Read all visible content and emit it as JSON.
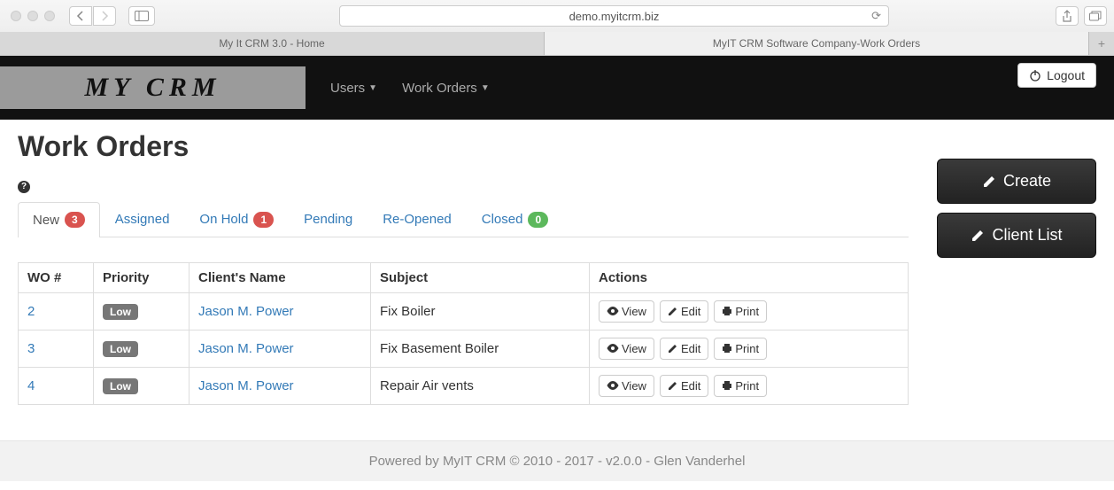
{
  "browser": {
    "url": "demo.myitcrm.biz",
    "tabs": [
      {
        "title": "My It CRM 3.0 - Home",
        "active": false
      },
      {
        "title": "MyIT CRM Software Company-Work Orders",
        "active": true
      }
    ]
  },
  "navbar": {
    "brand": "MY CRM",
    "menu": {
      "users": "Users",
      "work_orders": "Work Orders"
    },
    "logout": "Logout"
  },
  "page": {
    "title": "Work Orders"
  },
  "tabs": [
    {
      "label": "New",
      "badge": "3",
      "badge_color": "red",
      "active": true
    },
    {
      "label": "Assigned",
      "badge": null,
      "active": false
    },
    {
      "label": "On Hold",
      "badge": "1",
      "badge_color": "red",
      "active": false
    },
    {
      "label": "Pending",
      "badge": null,
      "active": false
    },
    {
      "label": "Re-Opened",
      "badge": null,
      "active": false
    },
    {
      "label": "Closed",
      "badge": "0",
      "badge_color": "green",
      "active": false
    }
  ],
  "table": {
    "headers": {
      "wo": "WO #",
      "priority": "Priority",
      "client": "Client's Name",
      "subject": "Subject",
      "actions": "Actions"
    },
    "action_labels": {
      "view": "View",
      "edit": "Edit",
      "print": "Print"
    },
    "rows": [
      {
        "wo": "2",
        "priority": "Low",
        "client": "Jason M. Power",
        "subject": "Fix Boiler"
      },
      {
        "wo": "3",
        "priority": "Low",
        "client": "Jason M. Power",
        "subject": "Fix Basement Boiler"
      },
      {
        "wo": "4",
        "priority": "Low",
        "client": "Jason M. Power",
        "subject": "Repair Air vents"
      }
    ]
  },
  "sidebar_actions": {
    "create": "Create",
    "client_list": "Client List"
  },
  "footer": "Powered by MyIT CRM © 2010 - 2017 - v2.0.0 - Glen Vanderhel"
}
